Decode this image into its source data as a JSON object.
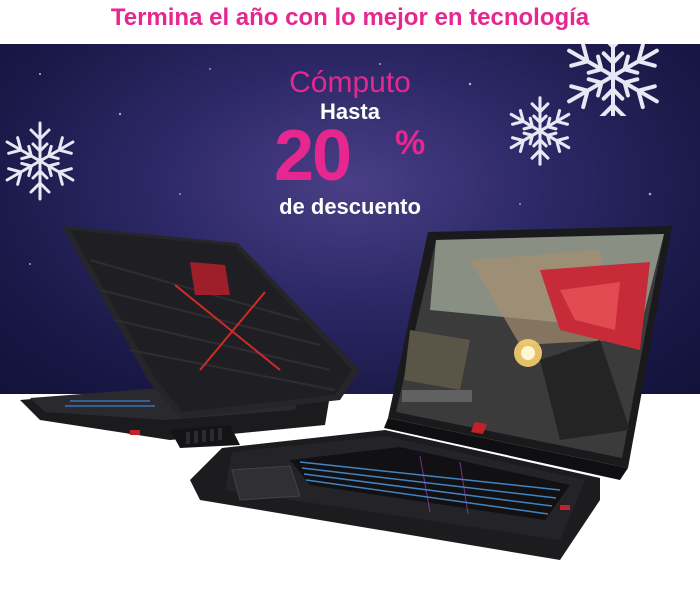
{
  "headline": "Termina el año con lo mejor en tecnología",
  "promo": {
    "category": "Cómputo",
    "prefix": "Hasta",
    "discount": "20",
    "percent_sign": "%",
    "suffix": "de descuento"
  },
  "colors": {
    "accent": "#e6278f",
    "banner_bg": "#2c2866",
    "text": "#ffffff"
  },
  "icons": [
    "snowflake-icon",
    "laptop-back-image",
    "laptop-front-image"
  ]
}
